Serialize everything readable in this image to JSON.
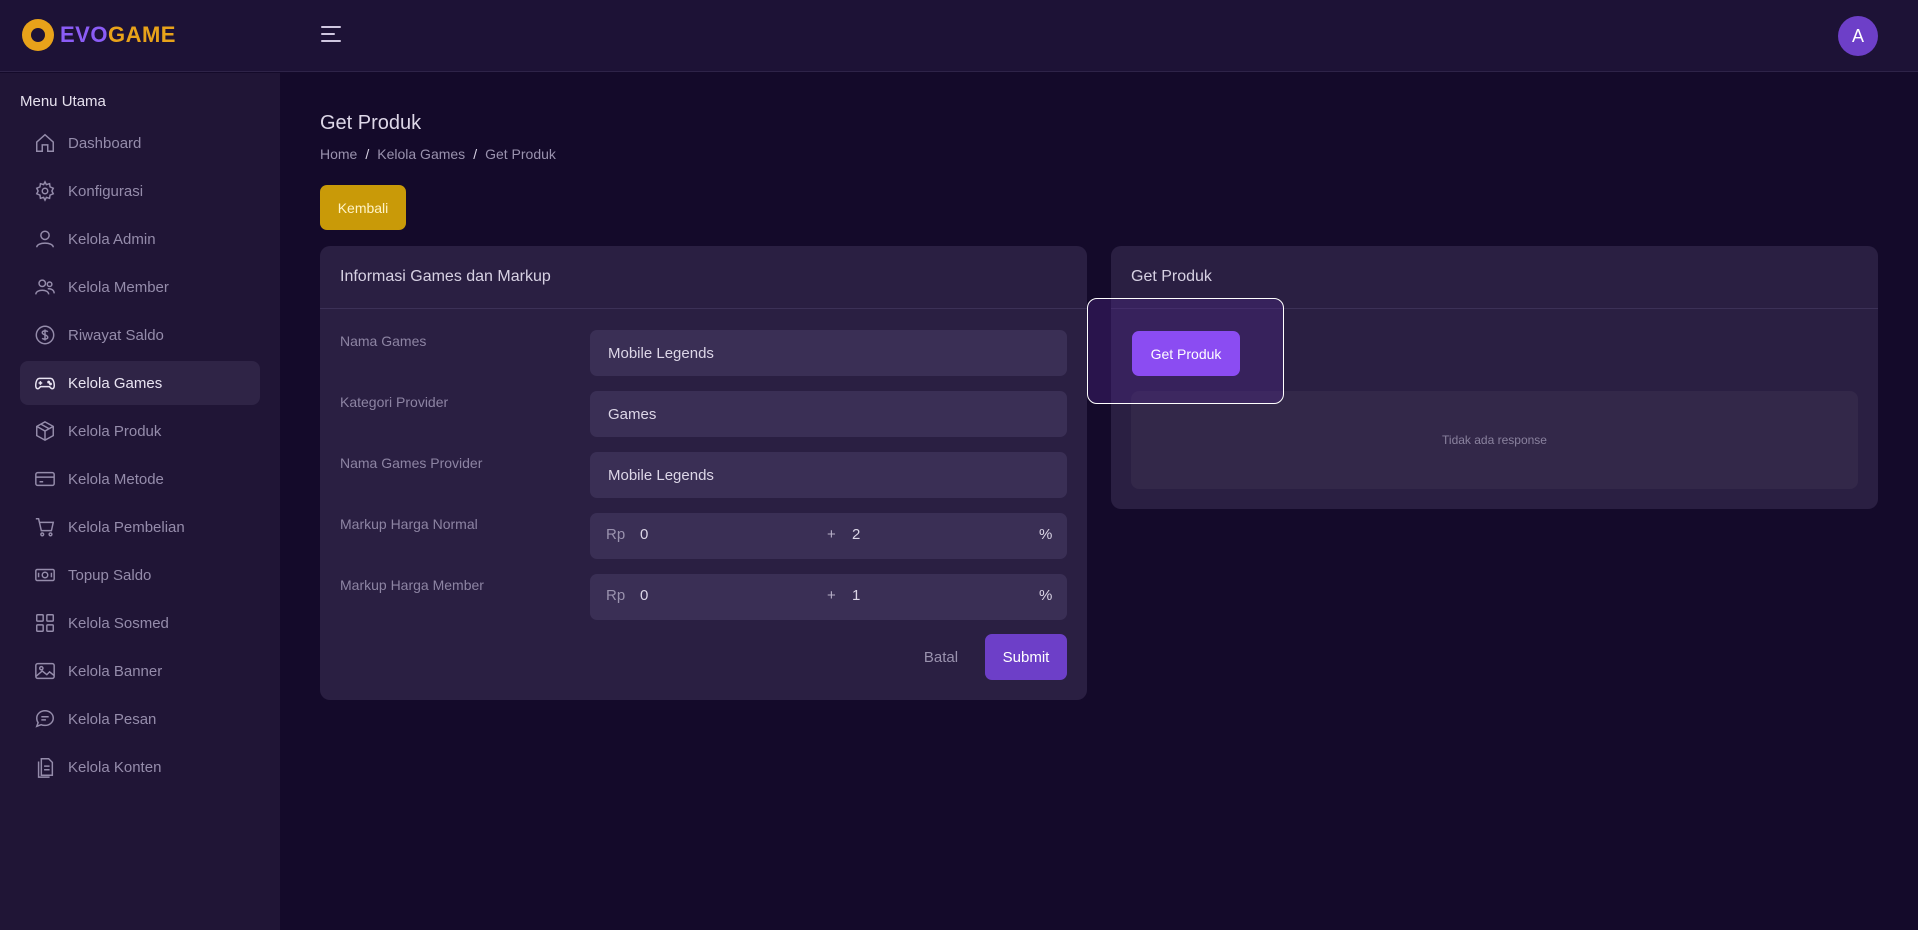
{
  "brand": {
    "name_part1": "EVO",
    "name_part2": "GAME"
  },
  "header": {
    "avatar_initial": "A"
  },
  "sidebar": {
    "title": "Menu Utama",
    "items": [
      {
        "label": "Dashboard",
        "icon": "home-icon"
      },
      {
        "label": "Konfigurasi",
        "icon": "gear-icon"
      },
      {
        "label": "Kelola Admin",
        "icon": "user-icon"
      },
      {
        "label": "Kelola Member",
        "icon": "users-icon"
      },
      {
        "label": "Riwayat Saldo",
        "icon": "dollar-icon"
      },
      {
        "label": "Kelola Games",
        "icon": "gamepad-icon",
        "active": true
      },
      {
        "label": "Kelola Produk",
        "icon": "box-icon"
      },
      {
        "label": "Kelola Metode",
        "icon": "card-icon"
      },
      {
        "label": "Kelola Pembelian",
        "icon": "cart-icon"
      },
      {
        "label": "Topup Saldo",
        "icon": "money-icon"
      },
      {
        "label": "Kelola Sosmed",
        "icon": "grid-icon"
      },
      {
        "label": "Kelola Banner",
        "icon": "image-icon"
      },
      {
        "label": "Kelola Pesan",
        "icon": "chat-icon"
      },
      {
        "label": "Kelola Konten",
        "icon": "document-icon"
      }
    ]
  },
  "page": {
    "title": "Get Produk",
    "breadcrumb": [
      "Home",
      "Kelola Games",
      "Get Produk"
    ],
    "breadcrumb_sep": "/",
    "back_button": "Kembali"
  },
  "form_card": {
    "title": "Informasi Games dan Markup",
    "fields": {
      "nama_games": {
        "label": "Nama Games",
        "value": "Mobile Legends"
      },
      "kategori_provider": {
        "label": "Kategori Provider",
        "value": "Games"
      },
      "nama_games_provider": {
        "label": "Nama Games Provider",
        "value": "Mobile Legends"
      },
      "markup_normal": {
        "label": "Markup Harga Normal",
        "prefix": "Rp",
        "amount": "0",
        "plus": "+",
        "percent": "2",
        "suffix": "%"
      },
      "markup_member": {
        "label": "Markup Harga Member",
        "prefix": "Rp",
        "amount": "0",
        "plus": "+",
        "percent": "1",
        "suffix": "%"
      }
    },
    "cancel_label": "Batal",
    "submit_label": "Submit"
  },
  "get_card": {
    "title": "Get Produk",
    "button_label": "Get Produk",
    "response_text": "Tidak ada response"
  },
  "colors": {
    "background": "#140a2a",
    "sidebar": "#201536",
    "accent": "#6d3fc8",
    "warning": "#c99a08"
  }
}
